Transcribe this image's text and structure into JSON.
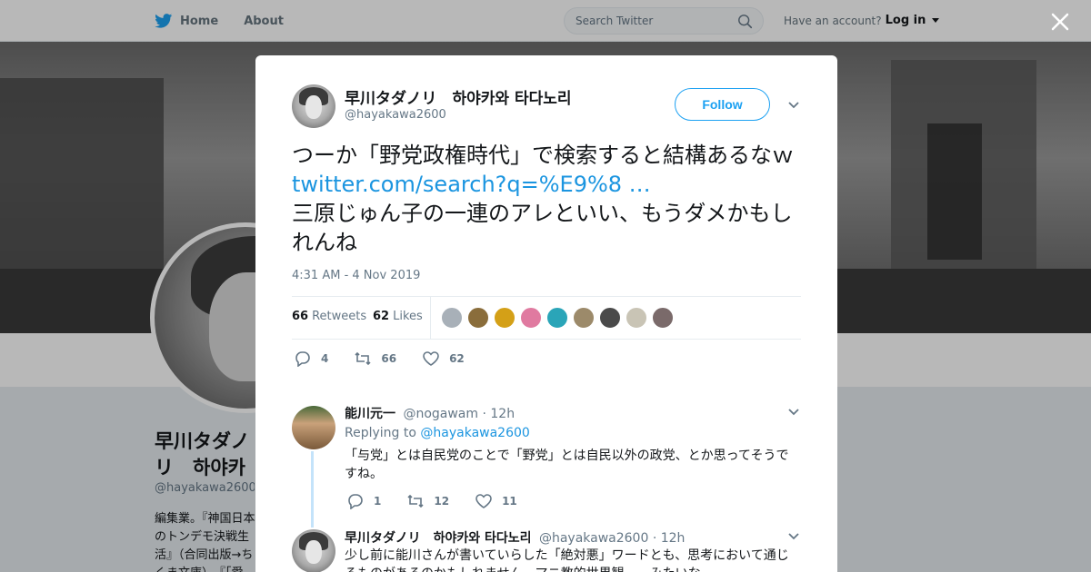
{
  "nav": {
    "home": "Home",
    "about": "About",
    "search_placeholder": "Search Twitter",
    "have_account": "Have an account?",
    "login": "Log in"
  },
  "profile": {
    "name": "早川タダノリ　하야카와 타다노리",
    "handle": "@hayakawa2600",
    "bio": "編集業。『神国日本のトンデモ決戦生活』（合同出版→ちくま文庫）、『「愛国」の技法』（青弓社）、『原発ユートピア日本』（合同出版）"
  },
  "tweet": {
    "author_name": "早川タダノリ　하야카와 타다노리",
    "author_handle": "@hayakawa2600",
    "follow_label": "Follow",
    "text_before": "つーか「野党政権時代」で検索すると結構あるなｗ　",
    "link": "twitter.com/search?q=%E9%8 …",
    "text_after": "三原じゅん子の一連のアレといい、もうダメかもしれんね",
    "timestamp": "4:31 AM - 4 Nov 2019",
    "retweets_count": "66",
    "retweets_label": "Retweets",
    "likes_count": "62",
    "likes_label": "Likes",
    "likers": [
      "#a8b0b8",
      "#8a6d3b",
      "#d4a017",
      "#e07aa0",
      "#2aa5b8",
      "#9c8a6a",
      "#4a4a4a",
      "#c9c4b5",
      "#7a6a6a"
    ],
    "actions": {
      "replies": "4",
      "retweets": "66",
      "likes": "62"
    }
  },
  "replies": [
    {
      "name": "能川元一",
      "handle": "@nogawam",
      "time": "· 12h",
      "replying_to_label": "Replying to",
      "replying_to": "@hayakawa2600",
      "text": "「与党」とは自民党のことで「野党」とは自民以外の政党、とか思ってそうですね。",
      "actions": {
        "replies": "1",
        "retweets": "12",
        "likes": "11"
      }
    },
    {
      "name": "早川タダノリ　하야카와 타다노리",
      "handle": "@hayakawa2600",
      "time": "· 12h",
      "text": "少し前に能川さんが書いていらした「絶対悪」ワードとも、思考において通じるものがあるのかもしれません。マニ教的世界観……みたいな"
    }
  ]
}
